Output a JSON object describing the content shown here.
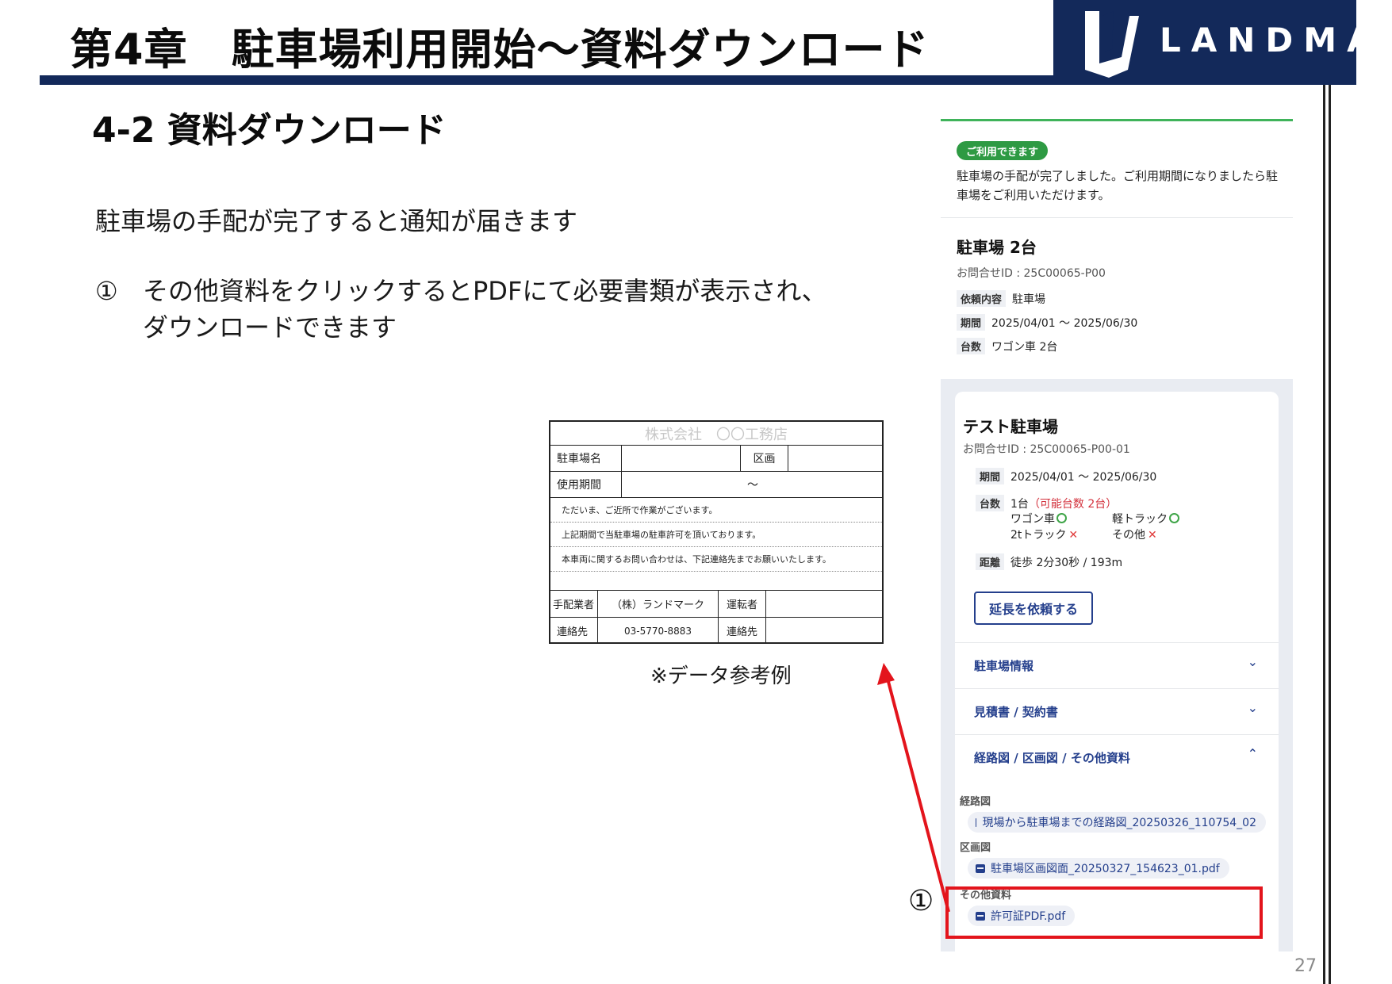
{
  "header": {
    "chapter_title": "第4章　駐車場利用開始～資料ダウンロード",
    "logo_text": "LANDMARK",
    "page_number": "27"
  },
  "section": {
    "title": "4-2 資料ダウンロード",
    "intro": "駐車場の手配が完了すると通知が届きます",
    "step_number": "①",
    "step_line1": "その他資料をクリックするとPDFにて必要書類が表示され、",
    "step_line2": "ダウンロードできます"
  },
  "permit_sample": {
    "company": "株式会社　〇〇工務店",
    "lot_name_label": "駐車場名",
    "section_label": "区画",
    "period_label": "使用期間",
    "period_sep": "～",
    "note1": "ただいま、ご近所で作業がございます。",
    "note2": "上記期間で当駐車場の駐車許可を頂いております。",
    "note3": "本車両に関するお問い合わせは、下記連絡先までお願いいたします。",
    "arranger_label": "手配業者",
    "arranger_value": "（株）ランドマーク",
    "driver_label": "運転者",
    "contact_label": "連絡先",
    "contact_value": "03-5770-8883",
    "contact_label2": "連絡先",
    "caption": "※データ参考例"
  },
  "panel": {
    "status_badge": "ご利用できます",
    "notice": "駐車場の手配が完了しました。ご利用期間になりましたら駐車場をご利用いただけます。",
    "lot_title": "駐車場 2台",
    "inquiry": "お問合せID : 25C00065-P00",
    "req_key": "依頼内容",
    "req_val": "駐車場",
    "period_key": "期間",
    "period_val": "2025/04/01 ～ 2025/06/30",
    "count_key": "台数",
    "count_val": "ワゴン車 2台",
    "card": {
      "title": "テスト駐車場",
      "inquiry": "お問合せID : 25C00065-P00-01",
      "period_key": "期間",
      "period_val": "2025/04/01 ～ 2025/06/30",
      "count_key": "台数",
      "count_val": "1台",
      "count_avail": "（可能台数 2台）",
      "wagon": "ワゴン車",
      "kei_truck": "軽トラック",
      "truck_2t": "2tトラック",
      "other": "その他",
      "distance_key": "距離",
      "distance_val": "徒歩 2分30秒 / 193m",
      "extend_button": "延長を依頼する"
    },
    "accordions": [
      {
        "label": "駐車場情報",
        "chevron": "⌄"
      },
      {
        "label": "見積書 / 契約書",
        "chevron": "⌄"
      },
      {
        "label": "経路図 / 区画図 / その他資料",
        "chevron": "⌃"
      }
    ],
    "files": {
      "route_label": "経路図",
      "route_file": "現場から駐車場までの経路図_20250326_110754_02",
      "section_label": "区画図",
      "section_file": "駐車場区画図面_20250327_154623_01.pdf",
      "other_label": "その他資料",
      "other_file": "許可証PDF.pdf"
    }
  },
  "annotation": {
    "marker": "①",
    "color": "#e3141c"
  }
}
